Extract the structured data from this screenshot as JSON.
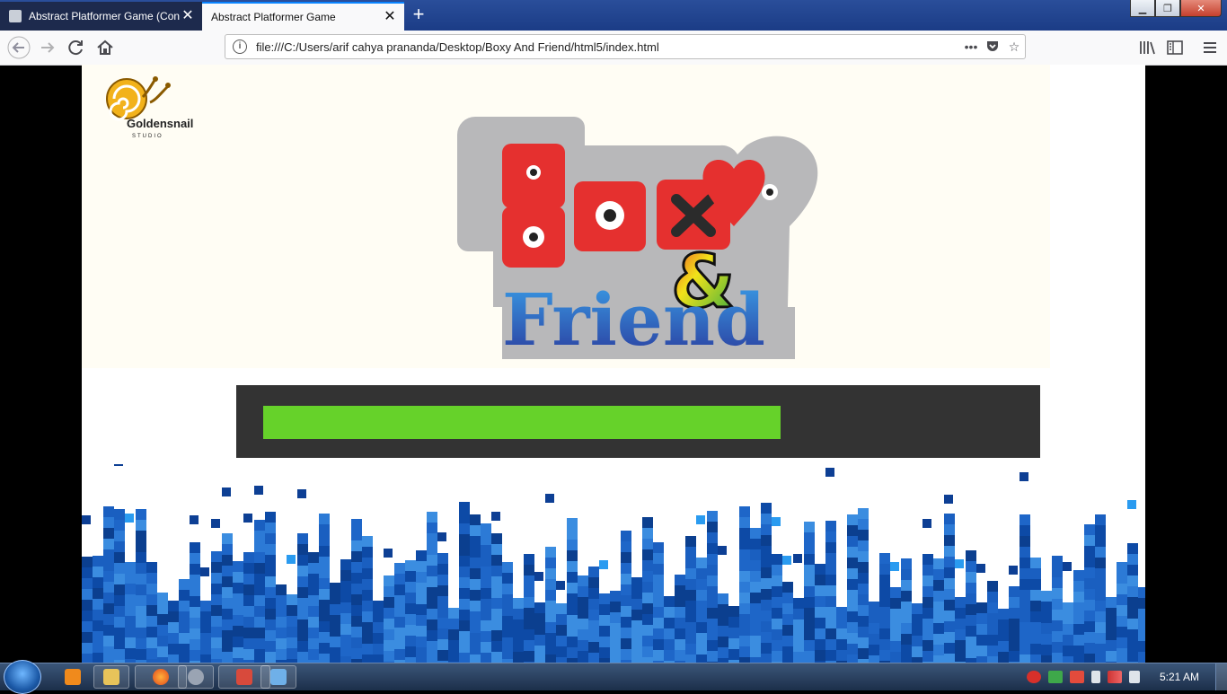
{
  "browser": {
    "tabs": [
      {
        "title": "Abstract Platformer Game (Con",
        "active": false
      },
      {
        "title": "Abstract Platformer Game",
        "active": true
      }
    ],
    "new_tab_symbol": "+",
    "close_symbol": "✕",
    "url": "file:///C:/Users/arif cahya prananda/Desktop/Boxy And Friend/html5/index.html",
    "nav_icons": [
      "back-icon",
      "forward-icon",
      "reload-icon",
      "home-icon"
    ],
    "url_icons": [
      "page-actions-icon",
      "pocket-icon",
      "bookmark-star-icon"
    ],
    "toolbar_icons": [
      "library-icon",
      "sidebar-icon",
      "menu-icon"
    ]
  },
  "page": {
    "studio_logo": {
      "name": "Goldensnail",
      "sub": "STUDIO"
    },
    "game_logo": {
      "title_top": "BOXY",
      "title_amp": "&",
      "title_bottom": "Friend"
    },
    "loading_progress": 0.69,
    "colors": {
      "loader_bg": "#333333",
      "loader_fill": "#66d22a",
      "hero_bg": "#fffdf4"
    }
  },
  "taskbar": {
    "apps": [
      "media-player-icon",
      "explorer-icon",
      "firefox-icon",
      "settings-icon",
      "app-icon",
      "paint-icon"
    ],
    "tray_icons": [
      "power-icon",
      "network-icon",
      "action-center-icon",
      "battery-icon",
      "signal-icon",
      "volume-icon"
    ],
    "clock": "5:21 AM"
  }
}
